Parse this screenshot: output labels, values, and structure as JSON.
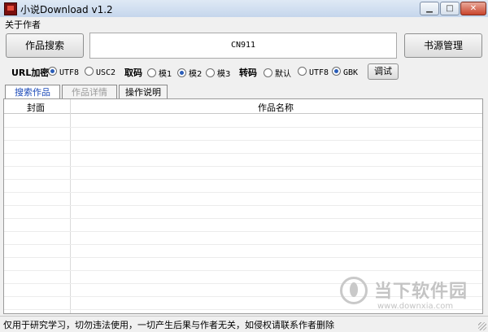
{
  "window": {
    "title": "小说Download v1.2",
    "min": "▁",
    "max": "□",
    "close": "✕"
  },
  "menu": {
    "about": "关于作者"
  },
  "toolbar": {
    "search_button": "作品搜索",
    "query_value": "CN911",
    "source_button": "书源管理"
  },
  "options": {
    "url_encode": {
      "label": "URL加密",
      "choices": [
        "UTF8",
        "USC2"
      ],
      "selected": "UTF8"
    },
    "fetch": {
      "label": "取码",
      "choices": [
        "模1",
        "模2",
        "模3"
      ],
      "selected": "模2"
    },
    "convert": {
      "label": "转码",
      "choices": [
        "默认",
        "UTF8",
        "GBK"
      ],
      "selected": "GBK"
    },
    "debug_button": "调试"
  },
  "tabs": [
    "搜索作品",
    "作品详情",
    "操作说明"
  ],
  "table": {
    "columns": [
      "封面",
      "作品名称"
    ],
    "rows": []
  },
  "watermark": {
    "title": "当下软件园",
    "url": "www.downxia.com"
  },
  "status": {
    "text": "仅用于研究学习，切勿违法使用，一切产生后果与作者无关，如侵权请联系作者删除"
  }
}
